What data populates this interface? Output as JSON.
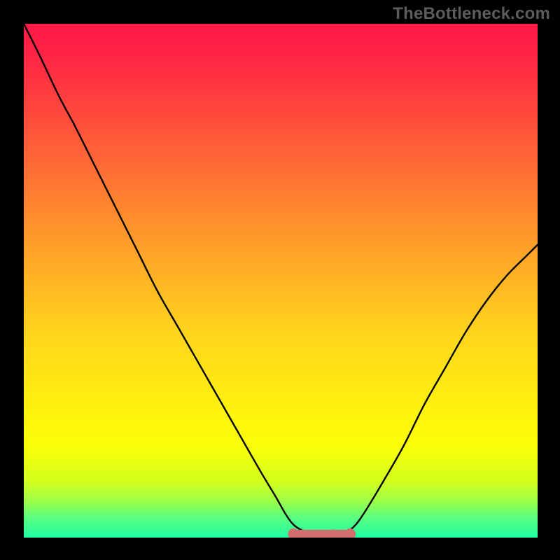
{
  "watermark": "TheBottleneck.com",
  "chart_data": {
    "type": "line",
    "title": "",
    "xlabel": "",
    "ylabel": "",
    "xlim": [
      0,
      100
    ],
    "ylim": [
      0,
      100
    ],
    "grid": false,
    "legend": false,
    "background": {
      "type": "vertical-gradient",
      "stops": [
        {
          "pos": 0.0,
          "color": "#ff1948"
        },
        {
          "pos": 0.07,
          "color": "#ff2644"
        },
        {
          "pos": 0.45,
          "color": "#ffa528"
        },
        {
          "pos": 0.6,
          "color": "#ffd41c"
        },
        {
          "pos": 0.75,
          "color": "#fff20e"
        },
        {
          "pos": 0.82,
          "color": "#fbff08"
        },
        {
          "pos": 0.89,
          "color": "#d3ff1c"
        },
        {
          "pos": 0.93,
          "color": "#9bff4a"
        },
        {
          "pos": 0.96,
          "color": "#5cff7e"
        },
        {
          "pos": 1.0,
          "color": "#1fffa4"
        }
      ]
    },
    "series": [
      {
        "name": "bottleneck-curve",
        "color": "#000000",
        "x": [
          0.0,
          3.0,
          6.8,
          10.0,
          14.0,
          18.0,
          22.0,
          26.0,
          30.0,
          34.0,
          38.0,
          42.0,
          46.0,
          49.0,
          51.0,
          52.5,
          54.0,
          56.0,
          58.0,
          60.0,
          62.0,
          63.5,
          65.0,
          67.0,
          70.0,
          74.0,
          78.0,
          82.0,
          86.0,
          90.0,
          94.0,
          98.0,
          100.0
        ],
        "y": [
          100.0,
          94.0,
          86.0,
          80.0,
          72.0,
          64.0,
          56.0,
          48.0,
          41.0,
          34.0,
          27.0,
          20.0,
          13.0,
          8.0,
          4.5,
          2.5,
          1.5,
          0.8,
          0.5,
          0.5,
          0.8,
          1.5,
          3.0,
          6.0,
          11.0,
          18.0,
          26.0,
          33.0,
          40.0,
          46.0,
          51.0,
          55.0,
          57.0
        ]
      }
    ],
    "highlight_band": {
      "name": "optimal-zone",
      "color": "#d46e6e",
      "x_range": [
        52.5,
        63.5
      ],
      "y": 0.7,
      "marker_size": 6
    }
  }
}
